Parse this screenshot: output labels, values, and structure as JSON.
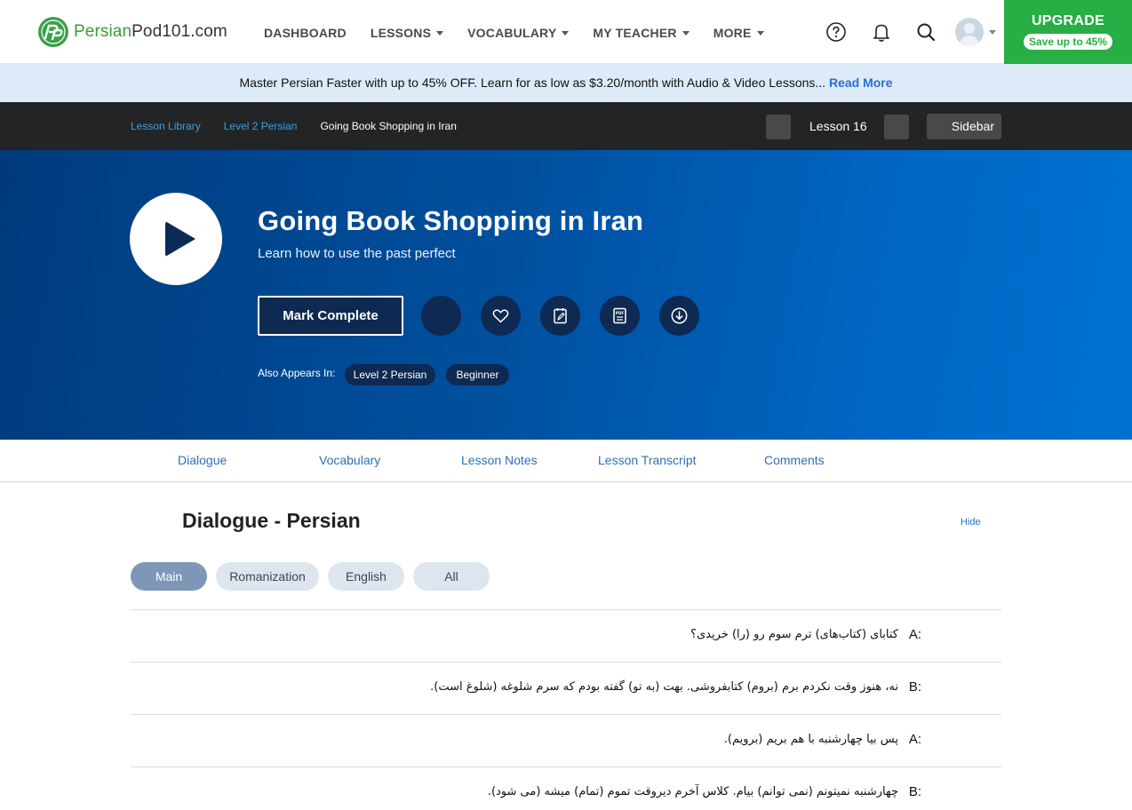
{
  "brand": {
    "name_accent": "Persian",
    "name_rest": "Pod101.com"
  },
  "nav": {
    "items": [
      {
        "label": "DASHBOARD",
        "dropdown": false
      },
      {
        "label": "LESSONS",
        "dropdown": true
      },
      {
        "label": "VOCABULARY",
        "dropdown": true
      },
      {
        "label": "MY TEACHER",
        "dropdown": true
      },
      {
        "label": "MORE",
        "dropdown": true
      }
    ],
    "icons": [
      "help-circle-icon",
      "bell-icon",
      "search-icon",
      "avatar"
    ]
  },
  "upgrade": {
    "title": "UPGRADE",
    "badge": "Save up to 45%"
  },
  "promo": {
    "text": "Master Persian Faster with up to 45% OFF. Learn for as low as $3.20/month with Audio & Video Lessons...",
    "link": "Read More"
  },
  "breadcrumb": {
    "items": [
      "Lesson Library",
      "Level 2 Persian",
      "Going Book Shopping in Iran"
    ],
    "lesson_label": "Lesson 16",
    "sidebar_label": "Sidebar"
  },
  "lesson": {
    "title": "Going Book Shopping in Iran",
    "subtitle": "Learn how to use the past perfect",
    "mark_complete": "Mark Complete",
    "action_icons": [
      "blank-circle-icon",
      "heart-icon",
      "note-icon",
      "pdf-icon",
      "download-icon"
    ],
    "also_appears_label": "Also Appears In:",
    "tags": [
      "Level 2 Persian",
      "Beginner"
    ]
  },
  "tabs": [
    "Dialogue",
    "Vocabulary",
    "Lesson Notes",
    "Lesson Transcript",
    "Comments"
  ],
  "dialogue": {
    "title": "Dialogue - Persian",
    "hide": "Hide",
    "modes": [
      "Main",
      "Romanization",
      "English",
      "All"
    ],
    "active_mode": "Main",
    "lines": [
      {
        "speaker": "A:",
        "text": "کتابای (کتاب‌های) ترم سوم رو (را) خریدی؟"
      },
      {
        "speaker": "B:",
        "text": "نه، هنوز وقت نکردم برم (بروم) کتابفروشی. بهت (به تو) گفته بودم که سرم شلوغه (شلوغ است)."
      },
      {
        "speaker": "A:",
        "text": "پس بیا چهارشنبه با هم بریم (برویم)."
      },
      {
        "speaker": "B:",
        "text": "چهارشنبه نمیتونم (نمی توانم) بیام. کلاس آخرم دیروقت تموم (تمام) میشه (می شود)."
      }
    ]
  }
}
